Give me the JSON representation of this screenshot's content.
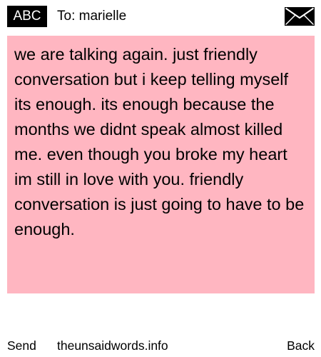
{
  "header": {
    "mode": "ABC",
    "recipient": "To: marielle",
    "icon": "envelope-icon"
  },
  "message": {
    "body": "we are talking again. just friendly conversation but i keep telling myself its enough. its enough because the months we didnt speak almost killed me. even though you broke my heart im still in love with you. friendly conversation is just going to have to be enough.",
    "background_color": "#ffb6c1"
  },
  "footer": {
    "send_label": "Send",
    "site": "theunsaidwords.info",
    "back_label": "Back"
  }
}
